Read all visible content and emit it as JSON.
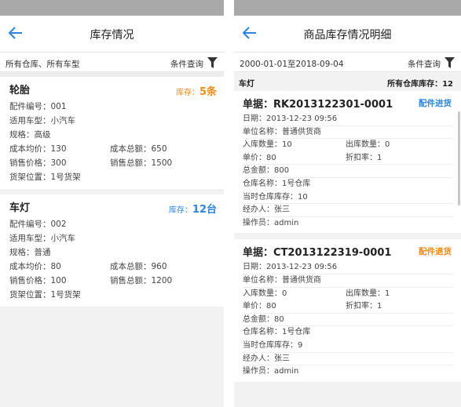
{
  "left": {
    "title": "库存情况",
    "filter_text": "所有仓库、所有车型",
    "query_label": "条件查询",
    "items": [
      {
        "name": "轮胎",
        "stock_label": "库存：",
        "stock_value": "5条",
        "part_no": "配件编号：001",
        "model": "适用车型：小汽车",
        "spec": "规格：高级",
        "avg_cost": "成本均价：130",
        "total_cost": "成本总额：650",
        "price": "销售价格：300",
        "total_sales": "销售总额：1500",
        "shelf": "货架位置：1号货架"
      },
      {
        "name": "车灯",
        "stock_label": "库存：",
        "stock_value": "12台",
        "part_no": "配件编号：002",
        "model": "适用车型：小汽车",
        "spec": "规格：普通",
        "avg_cost": "成本均价：80",
        "total_cost": "成本总额：960",
        "price": "销售价格：100",
        "total_sales": "销售总额：1200",
        "shelf": "货架位置：1号货架"
      }
    ]
  },
  "right": {
    "title": "商品库存情况明细",
    "date_range": "2000-01-01至2018-09-04",
    "query_label": "条件查询",
    "product": "车灯",
    "all_stock": "所有仓库库存：12",
    "records": [
      {
        "doc": "单据：RK2013122301-0001",
        "tag": "配件进货",
        "date": "日期：2013-12-23 09:56",
        "unit": "单位名称：普通供货商",
        "in_qty": "入库数量：10",
        "out_qty": "出库数量：0",
        "price": "单价：80",
        "discount": "折扣率：1",
        "total": "总金额：800",
        "warehouse": "仓库名称：1号仓库",
        "cur_stock": "当时仓库库存：10",
        "handler": "经办人：张三",
        "operator": "操作员：admin"
      },
      {
        "doc": "单据：CT2013122319-0001",
        "tag": "配件退货",
        "date": "日期：2013-12-23 09:56",
        "unit": "单位名称：普通供货商",
        "in_qty": "入库数量：0",
        "out_qty": "出库数量：1",
        "price": "单价：80",
        "discount": "折扣率：1",
        "total": "总金额：80",
        "warehouse": "仓库名称：1号仓库",
        "cur_stock": "当时仓库库存：9",
        "handler": "经办人：张三",
        "operator": "操作员：admin"
      }
    ]
  },
  "colors": {
    "accent_blue": "#2b86e3",
    "accent_orange": "#f08c1a",
    "status_bar": "#a9a9a9"
  },
  "icons": [
    "back-arrow-icon",
    "filter-funnel-icon"
  ]
}
